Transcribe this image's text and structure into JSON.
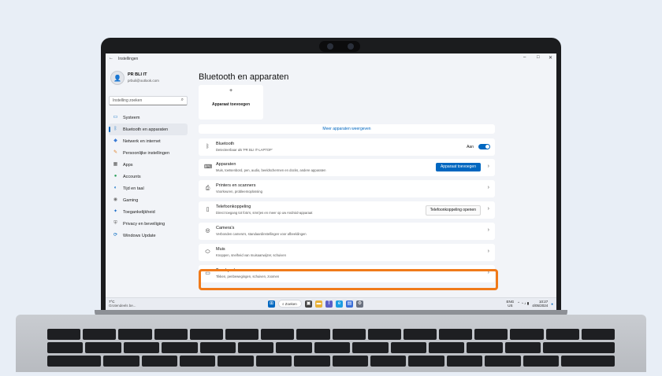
{
  "window": {
    "title": "Instellingen",
    "back": "←",
    "minimize": "–",
    "maximize": "□",
    "close": "✕"
  },
  "user": {
    "name": "PR BLI IT",
    "email": "prbuli@outlook.com",
    "avatar_icon": "👤"
  },
  "search": {
    "placeholder": "Instelling zoeken",
    "icon": "⌕"
  },
  "nav": [
    {
      "label": "Systeem",
      "icon": "system-icon",
      "glyph": "▭",
      "color": "#0067c0"
    },
    {
      "label": "Bluetooth en apparaten",
      "icon": "bluetooth-icon",
      "glyph": "ᛒ",
      "color": "#0067c0",
      "active": true
    },
    {
      "label": "Netwerk en internet",
      "icon": "wifi-icon",
      "glyph": "◆",
      "color": "#3a7bd5"
    },
    {
      "label": "Persoonlijke instellingen",
      "icon": "brush-icon",
      "glyph": "✎",
      "color": "#e0822a"
    },
    {
      "label": "Apps",
      "icon": "apps-icon",
      "glyph": "▦",
      "color": "#555"
    },
    {
      "label": "Accounts",
      "icon": "accounts-icon",
      "glyph": "●",
      "color": "#2aa05a"
    },
    {
      "label": "Tijd en taal",
      "icon": "globe-icon",
      "glyph": "◐",
      "color": "#0067c0"
    },
    {
      "label": "Gaming",
      "icon": "gaming-icon",
      "glyph": "◉",
      "color": "#777"
    },
    {
      "label": "Toegankelijkheid",
      "icon": "accessibility-icon",
      "glyph": "✦",
      "color": "#1d6fc9"
    },
    {
      "label": "Privacy en beveiliging",
      "icon": "shield-icon",
      "glyph": "⛨",
      "color": "#666"
    },
    {
      "label": "Windows Update",
      "icon": "update-icon",
      "glyph": "⟳",
      "color": "#0067c0"
    }
  ],
  "content": {
    "title": "Bluetooth en apparaten",
    "add_tile": {
      "plus": "+",
      "label": "Apparaat toevoegen"
    },
    "more_link": "Meer apparaten weergeven",
    "bluetooth": {
      "title": "Bluetooth",
      "subtitle": "Detecteerbaar als 'PR BLI IT-LAPTOP'",
      "toggle_label": "Aan",
      "icon": "ᛒ"
    },
    "rows": [
      {
        "title": "Apparaten",
        "subtitle": "Muis, toetsenbord, pen, audio, beeldschermen en docks, andere apparaten",
        "icon": "devices-icon",
        "glyph": "⌨",
        "button": "Apparaat toevoegen",
        "button_style": "accent"
      },
      {
        "title": "Printers en scanners",
        "subtitle": "Voorkeuren, probleemoplossing",
        "icon": "printer-icon",
        "glyph": "⎙"
      },
      {
        "title": "Telefoonkoppeling",
        "subtitle": "Direct toegang tot foto's, sms'jes en meer op uw Android-apparaat",
        "icon": "phone-icon",
        "glyph": "▯",
        "button": "Telefoonkoppeling openen",
        "button_style": "plain"
      },
      {
        "title": "Camera's",
        "subtitle": "Verbonden camera's, standaardinstellingen voor afbeeldingen",
        "icon": "camera-icon",
        "glyph": "◎"
      },
      {
        "title": "Muis",
        "subtitle": "Knoppen, snelheid van muisaanwijzer, schuiven",
        "icon": "mouse-icon",
        "glyph": "⬭"
      },
      {
        "title": "Touchpad",
        "subtitle": "Tikken, penbewegingen, schuiven, zoomen",
        "icon": "touchpad-icon",
        "glyph": "▭",
        "highlighted": true
      }
    ],
    "chevron": "›"
  },
  "taskbar": {
    "weather": {
      "temp": "7°C",
      "desc": "Grotendeels be..."
    },
    "search_label": "⌕ Zoeken",
    "apps": [
      {
        "name": "start-icon",
        "glyph": "⊞",
        "color": "#0067c0"
      },
      {
        "name": "task-view-icon",
        "glyph": "▣",
        "color": "#444"
      },
      {
        "name": "file-explorer-icon",
        "glyph": "▬",
        "color": "#e8b23a"
      },
      {
        "name": "teams-icon",
        "glyph": "T",
        "color": "#5b5fc7"
      },
      {
        "name": "edge-icon",
        "glyph": "e",
        "color": "#1b9de2"
      },
      {
        "name": "store-icon",
        "glyph": "▤",
        "color": "#3a6fd8"
      },
      {
        "name": "settings-icon",
        "glyph": "⚙",
        "color": "#6b7280"
      }
    ],
    "lang": {
      "line1": "ENG",
      "line2": "US"
    },
    "tray_icons": "⌃ ◔ ♪ ▮",
    "time": "10:27",
    "date": "4/05/2024",
    "notification": "●"
  }
}
